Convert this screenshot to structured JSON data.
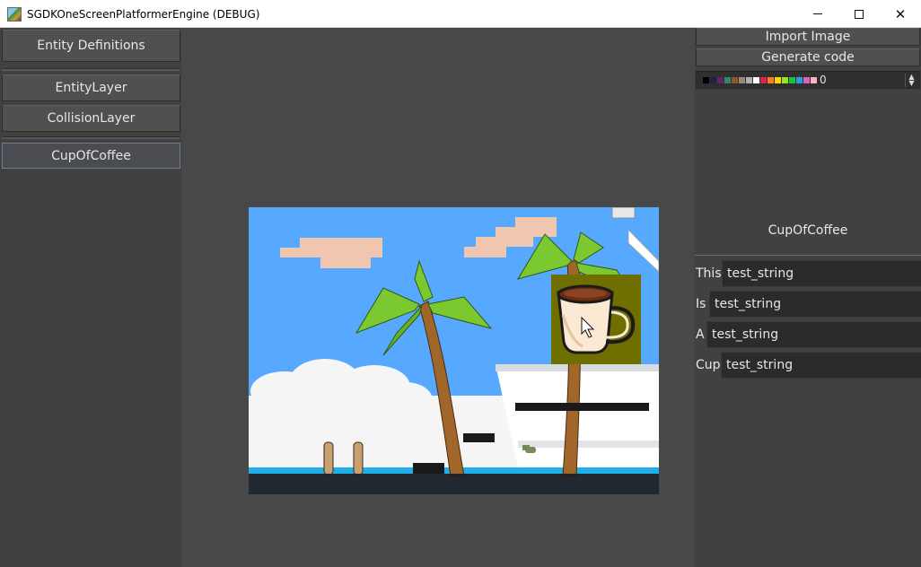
{
  "window": {
    "title": "SGDKOneScreenPlatformerEngine (DEBUG)",
    "min_icon": "minimize-icon",
    "max_icon": "maximize-icon",
    "close_icon": "close-icon",
    "close_glyph": "✕"
  },
  "left_panel": {
    "entity_definitions_label": "Entity Definitions",
    "layers": [
      {
        "label": "EntityLayer"
      },
      {
        "label": "CollisionLayer"
      }
    ],
    "entities": [
      {
        "label": "CupOfCoffee",
        "selected": true
      }
    ]
  },
  "right_panel": {
    "import_image_label": "Import Image",
    "generate_code_label": "Generate code",
    "palette": {
      "value": "0",
      "colors": [
        "#000000",
        "#202048",
        "#6a1f6a",
        "#2e8a6a",
        "#8a5a2a",
        "#9a8a7a",
        "#b0b0b0",
        "#ffffff",
        "#e02050",
        "#ff7a20",
        "#ffd800",
        "#a0e020",
        "#20c040",
        "#20a0e0",
        "#e060c0",
        "#ffb0c0"
      ]
    },
    "entity": {
      "name": "CupOfCoffee",
      "properties": [
        {
          "label": "This",
          "value": "test_string"
        },
        {
          "label": "Is",
          "value": "test_string"
        },
        {
          "label": "A",
          "value": "test_string"
        },
        {
          "label": "Cup",
          "value": "test_string"
        }
      ]
    }
  },
  "canvas": {
    "sky_color": "#57a8ff",
    "cloud_color": "#f0c6b0",
    "selection_color": "#6f6f00",
    "sprite_icon": "coffee-cup-icon",
    "cursor_icon": "mouse-cursor-icon"
  },
  "status": {
    "text": "........ ....... ......"
  }
}
